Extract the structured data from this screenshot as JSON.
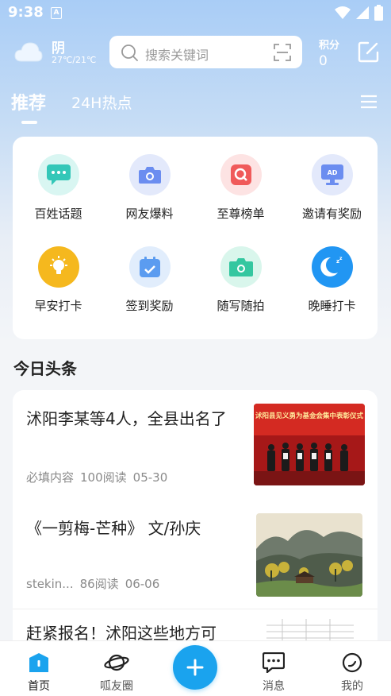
{
  "status": {
    "time": "9:38",
    "a_badge": "A"
  },
  "header": {
    "weather_condition": "阴",
    "weather_temp": "27℃/21℃",
    "search_placeholder": "搜索关键词",
    "points_label": "积分",
    "points_value": "0"
  },
  "tabs": [
    {
      "label": "推荐",
      "active": true
    },
    {
      "label": "24H热点",
      "active": false
    }
  ],
  "quick_entries": [
    {
      "label": "百姓话题",
      "icon": "chat-icon",
      "color": "#34c7b8"
    },
    {
      "label": "网友爆料",
      "icon": "camera-icon",
      "color": "#6b8df0"
    },
    {
      "label": "至尊榜单",
      "icon": "ranking-icon",
      "color": "#f05a5a"
    },
    {
      "label": "邀请有奖励",
      "icon": "ad-icon",
      "color": "#6b8df0"
    },
    {
      "label": "早安打卡",
      "icon": "bulb-icon",
      "color": "#f5b81e"
    },
    {
      "label": "签到奖励",
      "icon": "calendar-icon",
      "color": "#5b9cf0"
    },
    {
      "label": "随写随拍",
      "icon": "photo-icon",
      "color": "#34c7a0"
    },
    {
      "label": "晚睡打卡",
      "icon": "moon-icon",
      "color": "#2196f3"
    }
  ],
  "section_title": "今日头条",
  "news": [
    {
      "title": "沭阳李某等4人，全县出名了",
      "source": "必填内容",
      "reads": "100阅读",
      "date": "05-30",
      "banner_text": "沭阳县见义勇为基金会集中表彰仪式"
    },
    {
      "title": "《一剪梅-芒种》 文/孙庆",
      "source": "stekin...",
      "reads": "86阅读",
      "date": "06-06"
    },
    {
      "title": "赶紧报名！沭阳这些地方可"
    }
  ],
  "bottom_nav": [
    {
      "label": "首页",
      "icon": "home-icon",
      "active": true
    },
    {
      "label": "呱友圈",
      "icon": "planet-icon",
      "active": false
    },
    {
      "label": "消息",
      "icon": "message-icon",
      "active": false
    },
    {
      "label": "我的",
      "icon": "profile-icon",
      "active": false
    }
  ],
  "colors": {
    "accent": "#1aa3ee",
    "header_gradient_top": "#a9cdf6"
  }
}
